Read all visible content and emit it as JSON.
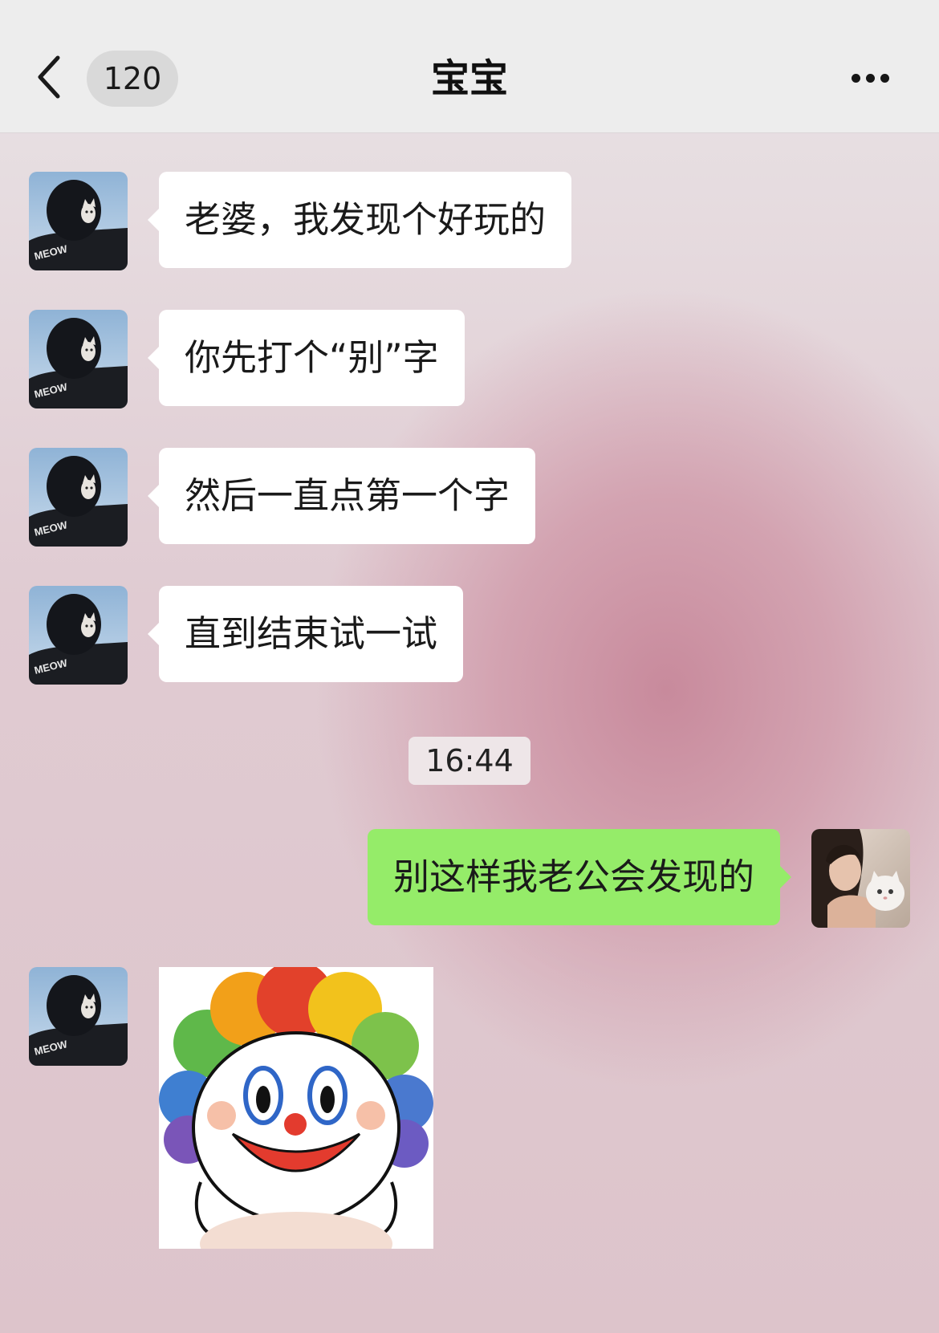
{
  "header": {
    "back_icon": "chevron-left-icon",
    "unread_count": "120",
    "title": "宝宝",
    "more_icon": "ellipsis-icon"
  },
  "messages": [
    {
      "side": "received",
      "text": "老婆，我发现个好玩的"
    },
    {
      "side": "received",
      "text": "你先打个“别”字"
    },
    {
      "side": "received",
      "text": "然后一直点第一个字"
    },
    {
      "side": "received",
      "text": "直到结束试一试"
    },
    {
      "side": "sent",
      "text": "别这样我老公会发现的"
    },
    {
      "side": "received",
      "type": "sticker",
      "sticker": "clown-sticker"
    }
  ],
  "timestamp": "16:44",
  "avatars": {
    "contact": {
      "picture": "person-with-cat-avatar",
      "printed_text": "MEOW"
    },
    "me": {
      "picture": "woman-with-white-cat-avatar"
    }
  },
  "colors": {
    "nav_bg": "#ededed",
    "received_bubble": "#ffffff",
    "sent_bubble": "#95ec69",
    "chat_bg_accent": "#c88a9c"
  }
}
